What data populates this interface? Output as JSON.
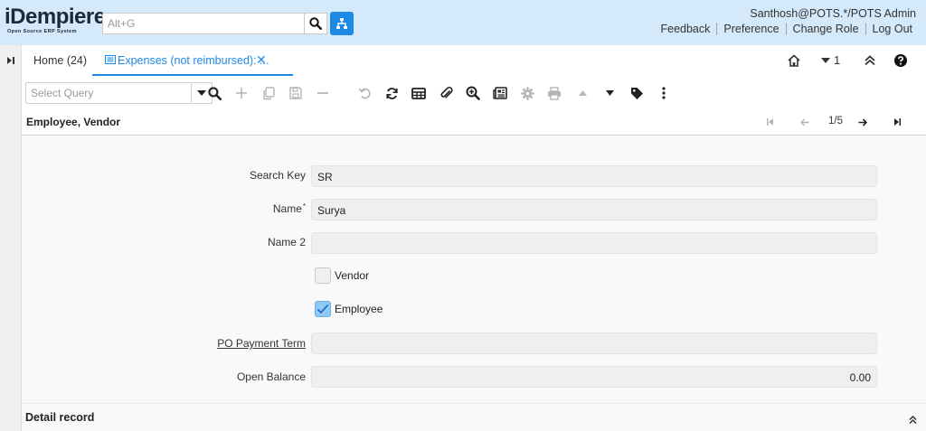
{
  "header": {
    "brand": "iDempiere",
    "brand_tagline": "Open Source ERP System",
    "search_placeholder": "Alt+G",
    "user": "Santhosh@POTS.*/POTS Admin",
    "links": [
      "Feedback",
      "Preference",
      "Change Role",
      "Log Out"
    ]
  },
  "tabs": {
    "home": "Home (24)",
    "active": "Expenses (not reimbursed): ...",
    "close_glyph": "✕",
    "window_count": "1"
  },
  "toolbar": {
    "query_placeholder": "Select Query",
    "icons": [
      "search-icon",
      "new-record-icon",
      "copy-icon",
      "save-icon",
      "delete-icon",
      "undo-icon",
      "refresh-icon",
      "grid-toggle-icon",
      "attachment-icon",
      "zoom-across-icon",
      "report-icon",
      "process-icon",
      "print-icon",
      "previous-arrow-icon",
      "more-dropdown-icon",
      "tag-icon",
      "kebab-menu-icon"
    ]
  },
  "record": {
    "title": "Employee, Vendor",
    "position": "1/5"
  },
  "form": {
    "search_key_label": "Search Key",
    "search_key_value": "SR",
    "name_label": "Name",
    "name_required": "*",
    "name_value": "Surya",
    "name2_label": "Name 2",
    "name2_value": "",
    "vendor_label": "Vendor",
    "vendor_checked": false,
    "employee_label": "Employee",
    "employee_checked": true,
    "po_payment_term_label": "PO Payment Term",
    "po_payment_term_value": "",
    "open_balance_label": "Open Balance",
    "open_balance_value": "0.00"
  },
  "detail": {
    "label": "Detail record"
  },
  "colors": {
    "header_bg": "#d4e9fa",
    "accent": "#1e88e5",
    "checkbox_checked": "#90c9f5"
  }
}
